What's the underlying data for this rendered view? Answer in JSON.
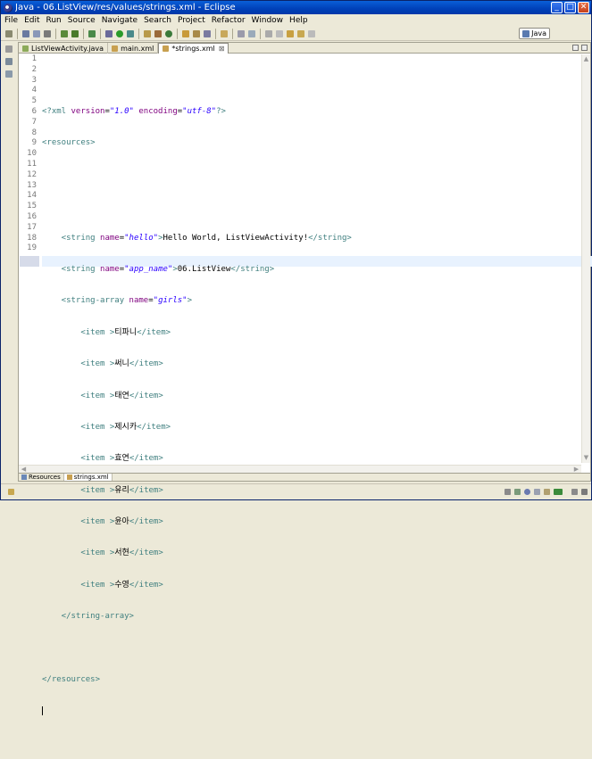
{
  "window": {
    "title": "Java - 06.ListView/res/values/strings.xml - Eclipse",
    "minimize": "_",
    "maximize": "□",
    "close": "✕"
  },
  "menu": [
    "File",
    "Edit",
    "Run",
    "Source",
    "Navigate",
    "Search",
    "Project",
    "Refactor",
    "Window",
    "Help"
  ],
  "perspective": {
    "label": "Java"
  },
  "tabs": [
    {
      "label": "ListViewActivity.java",
      "icon": "java-file-icon"
    },
    {
      "label": "main.xml",
      "icon": "xml-file-icon"
    },
    {
      "label": "*strings.xml",
      "icon": "xml-file-icon",
      "active": true,
      "close": "⊠"
    }
  ],
  "editor": {
    "line_numbers": [
      "1",
      "2",
      "3",
      "4",
      "5",
      "6",
      "7",
      "8",
      "9",
      "10",
      "11",
      "12",
      "13",
      "14",
      "15",
      "16",
      "17",
      "18",
      "19"
    ],
    "lines": {
      "l1_a": "<?xml ",
      "l1_b": "version",
      "l1_c": "=",
      "l1_d": "\"1.0\"",
      "l1_e": " encoding",
      "l1_f": "=",
      "l1_g": "\"utf-8\"",
      "l1_h": "?>",
      "l2": "<resources>",
      "l5_a": "    <string ",
      "l5_b": "name",
      "l5_c": "=",
      "l5_d": "\"hello\"",
      "l5_e": ">",
      "l5_f": "Hello World, ListViewActivity!",
      "l5_g": "</string>",
      "l6_a": "    <string ",
      "l6_b": "name",
      "l6_c": "=",
      "l6_d": "\"app_name\"",
      "l6_e": ">",
      "l6_f": "06.ListView",
      "l6_g": "</string>",
      "l7_a": "    <string-array ",
      "l7_b": "name",
      "l7_c": "=",
      "l7_d": "\"girls\"",
      "l7_e": ">",
      "items": [
        "티파니",
        "써니",
        "태연",
        "제시카",
        "효연",
        "유리",
        "윤아",
        "서현",
        "수영"
      ],
      "item_open": "        <item >",
      "item_close": "</item>",
      "l16": "    </string-array>",
      "l18": "</resources>"
    }
  },
  "bottom_tabs": [
    {
      "label": "Resources",
      "active": false
    },
    {
      "label": "strings.xml",
      "active": true
    }
  ]
}
